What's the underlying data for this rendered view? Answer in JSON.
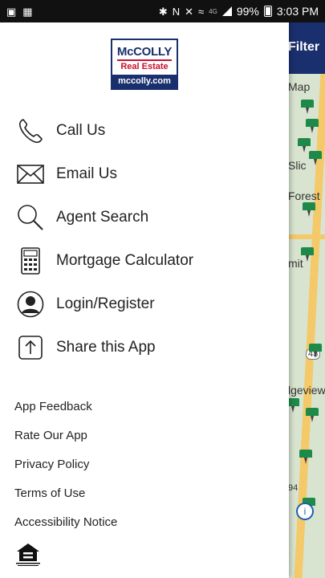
{
  "status_bar": {
    "battery": "99%",
    "time": "3:03 PM",
    "network": "4G"
  },
  "background_map": {
    "header_label": "Filter",
    "labels": [
      "Map",
      "Slic",
      "Forest",
      "mit",
      "43",
      "lgeview",
      "94"
    ]
  },
  "logo": {
    "line1": "McCOLLY",
    "line2": "Real Estate",
    "line3": "mccolly.com"
  },
  "menu": {
    "items": [
      {
        "label": "Call Us",
        "icon": "phone-icon"
      },
      {
        "label": "Email Us",
        "icon": "envelope-icon"
      },
      {
        "label": "Agent Search",
        "icon": "magnifier-icon"
      },
      {
        "label": "Mortgage Calculator",
        "icon": "calculator-icon"
      },
      {
        "label": "Login/Register",
        "icon": "user-icon"
      },
      {
        "label": "Share this App",
        "icon": "share-icon"
      }
    ]
  },
  "links": {
    "items": [
      {
        "label": "App Feedback"
      },
      {
        "label": "Rate Our App"
      },
      {
        "label": "Privacy Policy"
      },
      {
        "label": "Terms of Use"
      },
      {
        "label": "Accessibility Notice"
      }
    ]
  },
  "colors": {
    "brand_navy": "#1a2f6d",
    "brand_red": "#c8102e",
    "pin_green": "#1e8a4a"
  }
}
